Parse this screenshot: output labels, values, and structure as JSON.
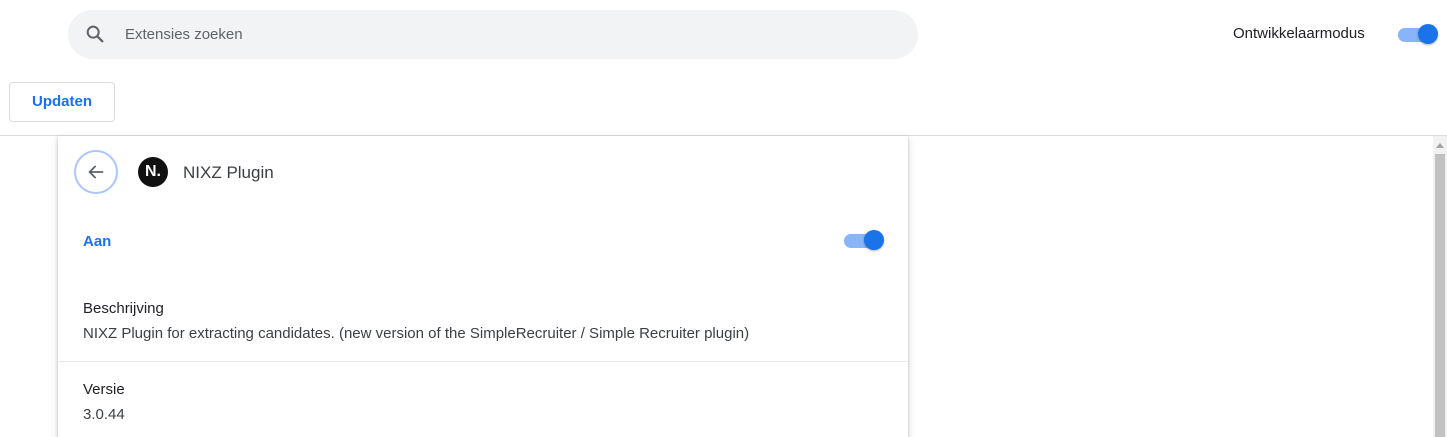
{
  "search": {
    "placeholder": "Extensies zoeken",
    "icon": "search-icon"
  },
  "header": {
    "devmode_label": "Ontwikkelaarmodus",
    "devmode_enabled": true
  },
  "toolbar": {
    "update_label": "Updaten"
  },
  "extension": {
    "logo_text": "N.",
    "name": "NIXZ Plugin",
    "status_label": "Aan",
    "enabled": true,
    "description_title": "Beschrijving",
    "description": "NIXZ Plugin for extracting candidates. (new version of the SimpleRecruiter / Simple Recruiter plugin)",
    "version_title": "Versie",
    "version": "3.0.44"
  },
  "colors": {
    "accent": "#1a73e8",
    "toggle_track": "#8ab4f8",
    "search_bg": "#f1f3f4",
    "logo_bg": "#111111"
  }
}
